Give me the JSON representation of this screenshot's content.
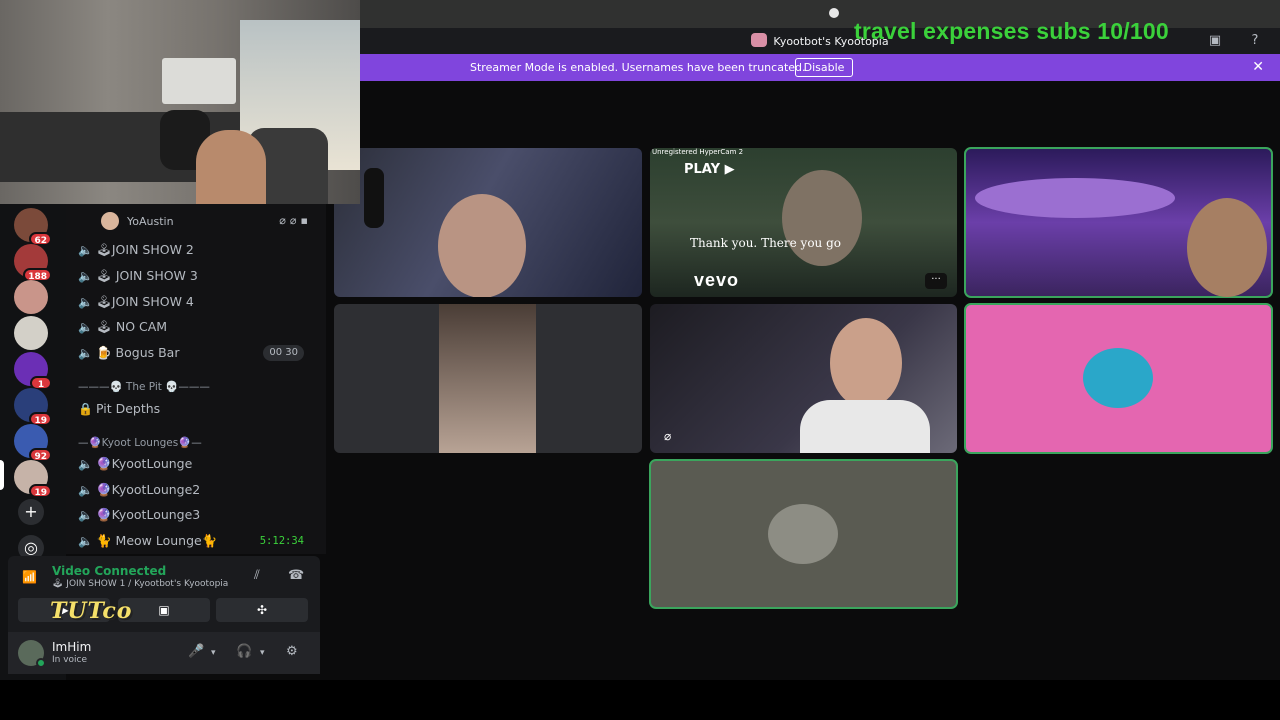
{
  "overlay": {
    "goal_text": "travel expenses subs 10/100",
    "brand_text": "TUTco"
  },
  "titlebar": {
    "server_title": "Kyootbot's Kyootopia",
    "screen_icon": "screen-share-icon",
    "help_icon": "help-icon"
  },
  "banner": {
    "message": "Streamer Mode is enabled. Usernames have been truncated.",
    "disable_label": "Disable",
    "close_icon": "close-icon"
  },
  "servers": [
    {
      "badge": "62",
      "color": "#7b4a3a"
    },
    {
      "badge": "188",
      "color": "#a33a3a"
    },
    {
      "badge": "",
      "color": "#c9958a"
    },
    {
      "badge": "",
      "color": "#d3d0c8"
    },
    {
      "badge": "1",
      "color": "#6b2fb5"
    },
    {
      "badge": "19",
      "color": "#2a3f7a"
    },
    {
      "badge": "92",
      "color": "#3a5bb0"
    },
    {
      "badge": "19",
      "color": "#c6b3a8"
    }
  ],
  "channels": {
    "member_name": "YoAustin",
    "items": [
      {
        "label": "🕹JOIN SHOW 2"
      },
      {
        "label": "🕹 JOIN SHOW 3"
      },
      {
        "label": "🕹JOIN SHOW 4"
      },
      {
        "label": "🕹 NO CAM"
      },
      {
        "label": "🍺 Bogus Bar",
        "count_a": "00",
        "count_b": "30"
      }
    ],
    "category_pit": "———💀 The Pit 💀———",
    "pit_depths": "Pit Depths",
    "category_lounges": "—🔮Kyoot Lounges🔮—",
    "lounges": [
      {
        "label": "🔮KyootLounge"
      },
      {
        "label": "🔮KyootLounge2"
      },
      {
        "label": "🔮KyootLounge3"
      }
    ],
    "meow": {
      "label": "🐈 Meow Lounge🐈",
      "timer": "5:12:34"
    }
  },
  "voice": {
    "status": "Video Connected",
    "location": "🕹 JOIN SHOW 1 / Kyootbot's Kyootopia"
  },
  "user": {
    "name": "ImHim",
    "status": "In voice"
  },
  "tiles": {
    "t2": {
      "hypercam": "Unregistered HyperCam 2",
      "play": "PLAY ▶",
      "caption": "Thank you. There you go",
      "vevo": "vevo"
    }
  },
  "colors": {
    "accent": "#8045dd",
    "live": "#23a55a",
    "overlay_green": "#3bd13b",
    "pink_tile": "#e466b0"
  }
}
